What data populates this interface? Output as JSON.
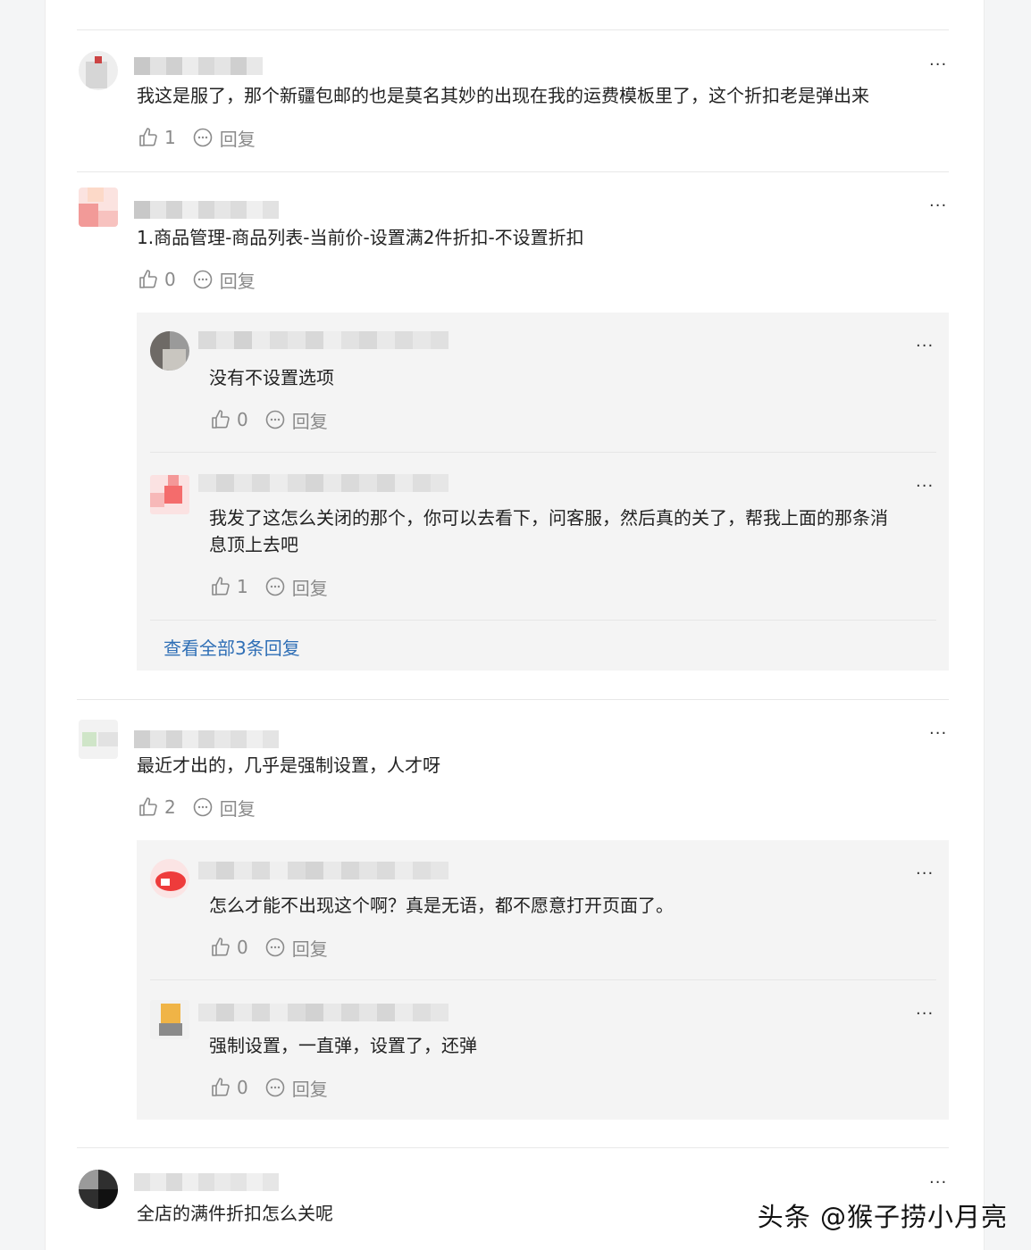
{
  "reply_label": "回复",
  "more_label": "···",
  "watermark": "头条 @猴子捞小月亮",
  "comments": [
    {
      "text": "我这是服了，那个新疆包邮的也是莫名其妙的出现在我的运费模板里了，这个折扣老是弹出来",
      "likes": "1"
    },
    {
      "text": "1.商品管理-商品列表-当前价-设置满2件折扣-不设置折扣",
      "likes": "0",
      "replies": [
        {
          "text": "没有不设置选项",
          "likes": "0"
        },
        {
          "text_line1": "我发了这怎么关闭的那个，你可以去看下，问客服，然后真的关了，帮我上面的那条消",
          "text_line2": "息顶上去吧",
          "likes": "1"
        }
      ],
      "view_all": "查看全部3条回复"
    },
    {
      "text": "最近才出的，几乎是强制设置，人才呀",
      "likes": "2",
      "replies": [
        {
          "text": "怎么才能不出现这个啊？真是无语，都不愿意打开页面了。",
          "likes": "0"
        },
        {
          "text": "强制设置，一直弹，设置了，还弹",
          "likes": "0"
        }
      ]
    },
    {
      "text": "全店的满件折扣怎么关呢"
    }
  ],
  "colors": {
    "link": "#2f6fb6",
    "reply_bg": "#f4f4f4",
    "meta": "#8a8a8a"
  },
  "icons": [
    "thumb-up-icon",
    "comment-bubble-icon",
    "more-dots-icon"
  ]
}
